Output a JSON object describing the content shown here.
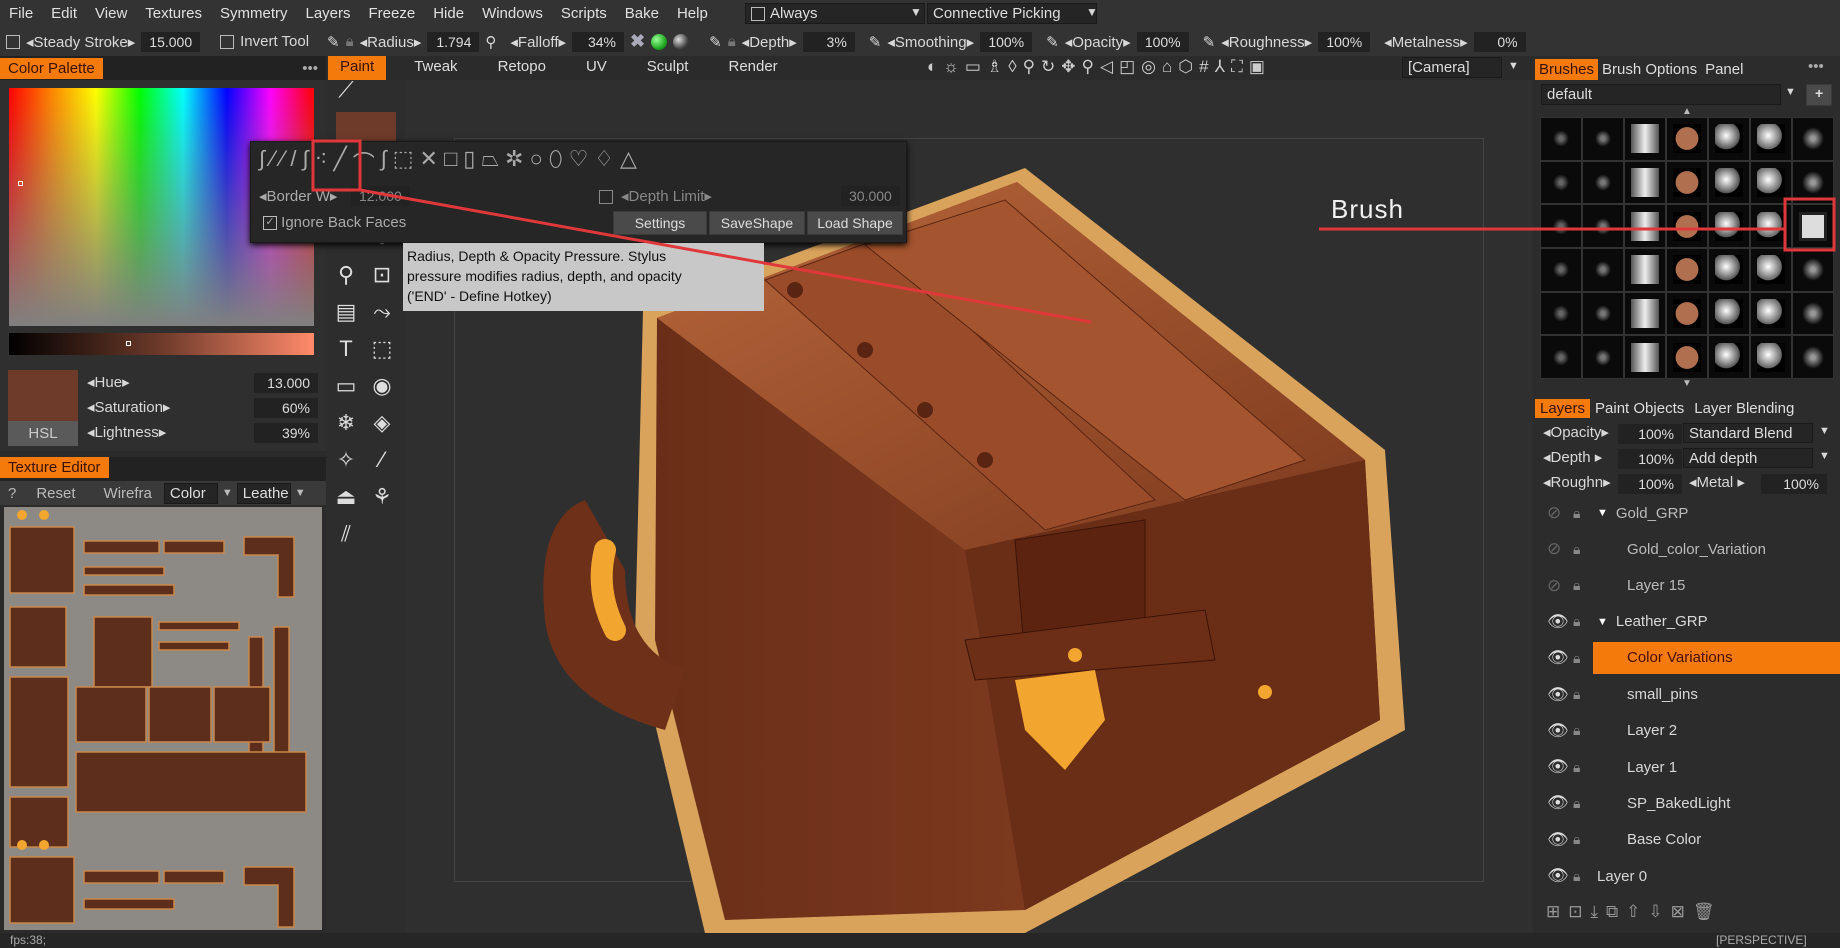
{
  "menu": [
    "File",
    "Edit",
    "View",
    "Textures",
    "Symmetry",
    "Layers",
    "Freeze",
    "Hide",
    "Windows",
    "Scripts",
    "Bake",
    "Help"
  ],
  "always": {
    "label": "Always"
  },
  "picking": {
    "label": "Connective Picking"
  },
  "toolbar": {
    "steady_stroke": "Steady Stroke",
    "steady_value": "15.000",
    "invert_tool": "Invert Tool",
    "radius": "Radius",
    "radius_value": "1.794",
    "falloff": "Falloff",
    "falloff_value": "34%",
    "depth": "Depth",
    "depth_value": "3%",
    "smoothing": "Smoothing",
    "smoothing_value": "100%",
    "opacity": "Opacity",
    "opacity_value": "100%",
    "roughness": "Roughness",
    "roughness_value": "100%",
    "metalness": "Metalness",
    "metalness_value": "0%"
  },
  "color_palette": {
    "title": "Color Palette",
    "more": "•••",
    "hue_label": "Hue",
    "hue": "13.000",
    "sat_label": "Saturation",
    "sat": "60%",
    "light_label": "Lightness",
    "light": "39%",
    "mode": "HSL",
    "color": "#6e3a2a"
  },
  "rooms": [
    "Paint",
    "Tweak",
    "Retopo",
    "UV",
    "Sculpt",
    "Render"
  ],
  "viewport": {
    "camera": "[Camera]",
    "status": "[PERSPECTIVE]",
    "fps": "fps:38;"
  },
  "texture_editor": {
    "title": "Texture Editor",
    "help": "?",
    "reset": "Reset",
    "wireframe": "Wirefra",
    "channel": "Color",
    "layer": "Leathe"
  },
  "stroke_popup": {
    "border_label": "Border W",
    "border_value": "12.000",
    "depth_limit": "Depth Limit",
    "depth_limit_value": "30.000",
    "ignore_back_faces": "Ignore Back Faces",
    "settings": "Settings",
    "save_shape": "SaveShape",
    "load_shape": "Load Shape"
  },
  "tooltip": {
    "line1": "Radius, Depth & Opacity Pressure. Stylus",
    "line2": "pressure modifies radius, depth, and opacity",
    "line3": "('END' - Define Hotkey)"
  },
  "annotation": {
    "label": "Brush"
  },
  "brushes": {
    "tabs": [
      "Brushes",
      "Brush Options",
      "Panel"
    ],
    "more": "•••",
    "preset": "default",
    "add": "+"
  },
  "layers": {
    "tabs": [
      "Layers",
      "Paint Objects",
      "Layer Blending"
    ],
    "opacity_label": "Opacity",
    "opacity": "100%",
    "blend": "Standard Blend",
    "depth_label": "Depth",
    "depth": "100%",
    "depth_mode": "Add depth",
    "rough_label": "Roughn",
    "rough": "100%",
    "metal_label": "Metal",
    "metal": "100%",
    "items": [
      {
        "name": "Gold_GRP",
        "visible": false,
        "group": true,
        "indent": 0
      },
      {
        "name": "Gold_color_Variation",
        "visible": false,
        "group": false,
        "indent": 1
      },
      {
        "name": "Layer 15",
        "visible": false,
        "group": false,
        "indent": 1
      },
      {
        "name": "Leather_GRP",
        "visible": true,
        "group": true,
        "indent": 0
      },
      {
        "name": "Color Variations",
        "visible": true,
        "group": false,
        "indent": 1,
        "selected": true
      },
      {
        "name": "small_pins",
        "visible": true,
        "group": false,
        "indent": 1
      },
      {
        "name": "Layer 2",
        "visible": true,
        "group": false,
        "indent": 1
      },
      {
        "name": "Layer 1",
        "visible": true,
        "group": false,
        "indent": 1
      },
      {
        "name": "SP_BakedLight",
        "visible": true,
        "group": false,
        "indent": 1
      },
      {
        "name": "Base Color",
        "visible": true,
        "group": false,
        "indent": 1
      },
      {
        "name": "Layer 0",
        "visible": true,
        "group": false,
        "indent": 0
      }
    ]
  },
  "colors": {
    "accent": "#f47a0c",
    "annotation": "#e0383a"
  }
}
